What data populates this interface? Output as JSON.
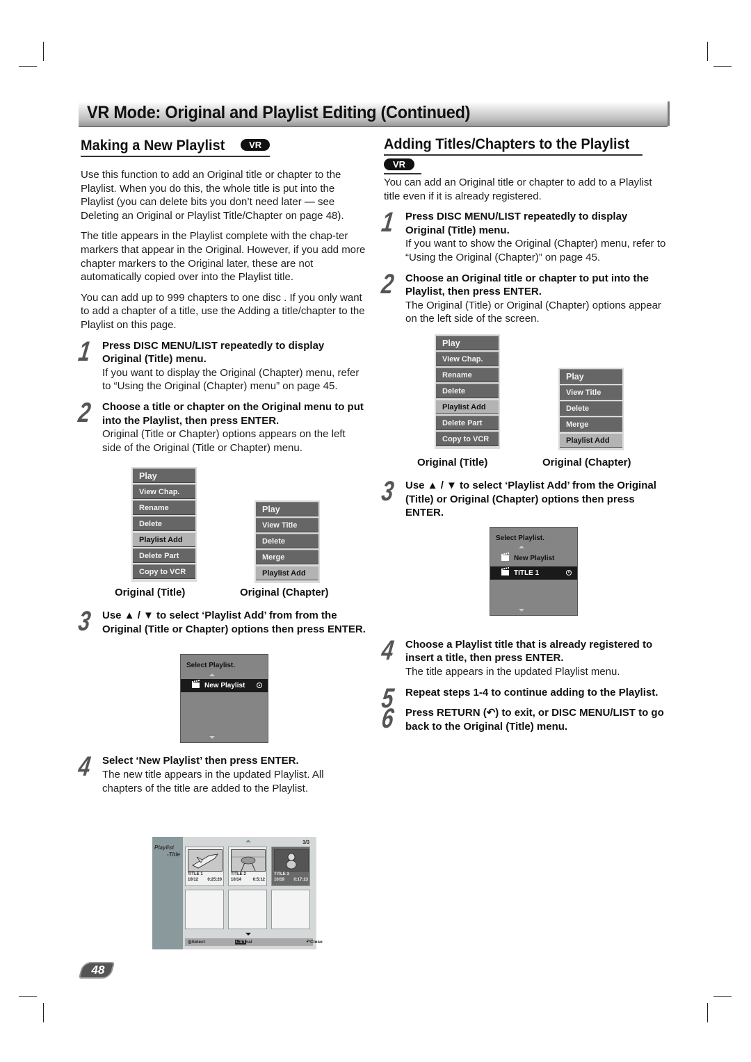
{
  "header": {
    "title": "VR Mode: Original and Playlist Editing (Continued)"
  },
  "left": {
    "heading": "Making a New Playlist",
    "badge": "VR",
    "paragraphs": [
      "Use this function to add an Original title or chapter to the Playlist. When you do this, the whole title is put into the Playlist (you can delete bits you don’t need later — see Deleting an Original or Playlist Title/Chapter on page 48).",
      "The title appears in the Playlist complete with the chap-ter markers that appear in the Original. However, if you add more chapter markers to the Original later, these are not automatically copied over into the Playlist title.",
      "You can add up to 999 chapters to one disc . If you only want to add a chapter of a title, use the Adding a title/chapter to the Playlist on this page."
    ],
    "steps": [
      {
        "num": "1",
        "bold": "Press DISC MENU/LIST repeatedly to display Original (Title) menu.",
        "text": "If you want to display the Original (Chapter) menu, refer to “Using the Original (Chapter) menu” on page 45."
      },
      {
        "num": "2",
        "bold": "Choose a title or chapter on the Original menu to put into the Playlist, then press ENTER.",
        "text": "Original (Title or Chapter) options appears on the left side of the Original (Title or Chapter) menu."
      },
      {
        "num": "3",
        "bold": "Use ▲ / ▼ to select ‘Playlist Add’ from from the Original (Title or Chapter) options then press ENTER.",
        "text": ""
      },
      {
        "num": "4",
        "bold": "Select ‘New Playlist’ then press ENTER.",
        "text": "The new title appears in the updated Playlist. All chapters of the title are added to the Playlist."
      }
    ],
    "select_dialog": {
      "title": "Select Playlist.",
      "rows": [
        "New Playlist"
      ],
      "active": "New Playlist"
    },
    "playlist_screen": {
      "side_label_1": "Playlist",
      "side_label_2": "-Title",
      "page_count": "3/3",
      "titles": [
        {
          "name": "TITLE 1",
          "date": "10/12",
          "duration": "0:25:20"
        },
        {
          "name": "TITLE 2",
          "date": "10/14",
          "duration": "0:5:12"
        },
        {
          "name": "TITLE 3",
          "date": "10/19",
          "duration": "0:17:23"
        }
      ],
      "bar": {
        "select": "Select",
        "list_badge": "LIST",
        "original": "Original",
        "close": "Close"
      }
    }
  },
  "menus": {
    "original_title": {
      "caption": "Original (Title)",
      "items": [
        "Play",
        "View Chap.",
        "Rename",
        "Delete",
        "Playlist Add",
        "Delete Part",
        "Copy to VCR"
      ],
      "selected": "Playlist Add"
    },
    "original_chapter": {
      "caption": "Original (Chapter)",
      "items": [
        "Play",
        "View Title",
        "Delete",
        "Merge",
        "Playlist Add"
      ],
      "selected": "Playlist Add"
    }
  },
  "right": {
    "heading": "Adding Titles/Chapters to the Playlist",
    "badge": "VR",
    "intro": "You can add an Original title or chapter to add to a Playlist title even if it is already registered.",
    "steps": [
      {
        "num": "1",
        "bold": "Press DISC MENU/LIST repeatedly to display Original (Title) menu.",
        "text": "If you want to show the Original (Chapter) menu, refer to “Using the Original (Chapter)” on page 45."
      },
      {
        "num": "2",
        "bold": "Choose an Original title or chapter to put into the Playlist, then press ENTER.",
        "text": "The Original (Title) or Original (Chapter) options appear on the left side of the screen."
      },
      {
        "num": "3",
        "bold": "Use ▲ / ▼ to select ‘Playlist Add’ from the Original (Title) or Original (Chapter) options then press ENTER.",
        "text": ""
      },
      {
        "num": "4",
        "bold": "Choose a Playlist title that is already registered to insert a title, then press ENTER.",
        "text": "The title appears in the updated Playlist menu."
      },
      {
        "num": "5",
        "bold": "Repeat steps 1-4 to continue adding to the Playlist.",
        "text": ""
      },
      {
        "num": "6",
        "bold": "Press RETURN (↶) to exit, or DISC MENU/LIST to go back to the Original (Title) menu.",
        "text": ""
      }
    ],
    "select_dialog": {
      "title": "Select Playlist.",
      "rows": [
        "New Playlist",
        "TITLE 1"
      ],
      "active": "TITLE 1"
    }
  },
  "footer": {
    "page_number": "48"
  }
}
